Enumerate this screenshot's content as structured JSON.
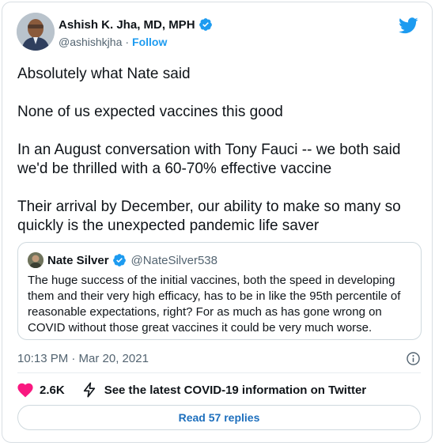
{
  "author": {
    "name": "Ashish K. Jha, MD, MPH",
    "handle": "@ashishkjha",
    "separator": "·",
    "follow_label": "Follow"
  },
  "tweet": {
    "text": "Absolutely what Nate said\n\nNone of us expected vaccines this good\n\nIn an August conversation with Tony Fauci -- we both said we'd be thrilled with a 60-70% effective vaccine\n\nTheir arrival by December, our ability to make so many so quickly is the unexpected pandemic life saver",
    "timestamp": "10:13 PM · Mar 20, 2021"
  },
  "quoted": {
    "name": "Nate Silver",
    "handle": "@NateSilver538",
    "text": "The huge success of the initial vaccines, both the speed in developing them and their very high efficacy, has to be in like the 95th percentile of reasonable expectations, right? For as much as has gone wrong on COVID without those great vaccines it could be very much worse."
  },
  "actions": {
    "likes": "2.6K",
    "covid_info": "See the latest COVID-19 information on Twitter",
    "replies_label": "Read 57 replies"
  },
  "icons": {
    "verified": "verified-badge-icon",
    "brand": "twitter-bird-icon",
    "info": "info-icon",
    "like": "heart-icon",
    "covid": "lightning-icon"
  },
  "colors": {
    "accent": "#1d9bf0",
    "like": "#f91880",
    "text": "#0f1419",
    "muted": "#536471",
    "border": "#cfd9de"
  }
}
